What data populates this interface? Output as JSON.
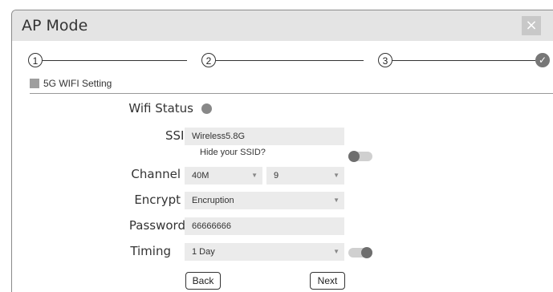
{
  "dialog": {
    "title": "AP Mode",
    "close_label": "×"
  },
  "steps": [
    "1",
    "2",
    "3"
  ],
  "steps_final": "✓",
  "section": {
    "title": "5G WIFI Setting"
  },
  "form": {
    "wifi_status_label": "Wifi Status",
    "ssid_label": "SSID",
    "ssid_value": "Wireless5.8G",
    "hide_ssid_label": "Hide your SSID?",
    "channel_label": "Channel",
    "channel_width": "40M",
    "channel_number": "9",
    "encrypt_label": "Encrypt",
    "encrypt_value": "Encruption",
    "password_label": "Password",
    "password_value": "66666666",
    "timing_label": "Timing",
    "timing_value": "1 Day"
  },
  "buttons": {
    "back": "Back",
    "next": "Next"
  },
  "icons": {
    "select_arrow": "▼"
  },
  "colors": {
    "title_bar": "#e4e4e4",
    "field_bg": "#ebebeb",
    "toggle_knob": "#6e6e6e"
  }
}
